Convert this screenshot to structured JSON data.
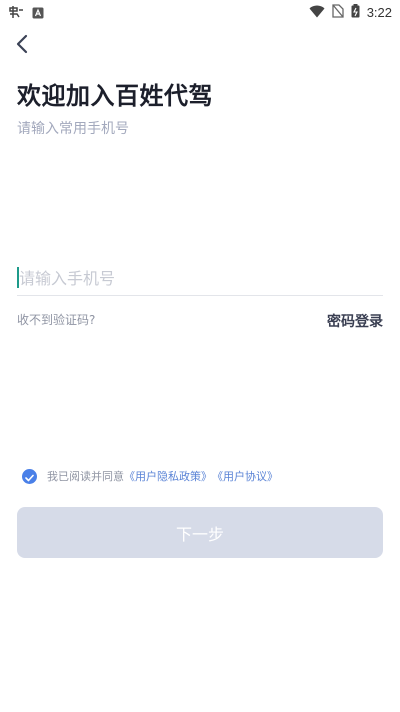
{
  "status_bar": {
    "time": "3:22",
    "icons": [
      "notification-app-icon",
      "a-badge-icon",
      "wifi-icon",
      "no-sim-icon",
      "battery-icon"
    ]
  },
  "header": {
    "back_icon": "chevron-left-icon",
    "title": "欢迎加入百姓代驾",
    "subtitle": "请输入常用手机号"
  },
  "form": {
    "phone_placeholder": "请输入手机号",
    "phone_value": "",
    "no_code_label": "收不到验证码?",
    "password_login_label": "密码登录"
  },
  "agreement": {
    "checked": true,
    "prefix": "我已阅读并同意",
    "privacy_link": "《用户隐私政策》",
    "user_link": "《用户协议》"
  },
  "actions": {
    "next_label": "下一步"
  },
  "colors": {
    "accent": "#4a80e8",
    "link": "#5b84d6",
    "button_disabled": "#d6dbe8",
    "cursor": "#1d9a8a"
  }
}
